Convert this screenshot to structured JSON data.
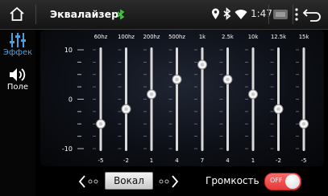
{
  "statusbar": {
    "title": "Эквалайзер",
    "clock": "1:47"
  },
  "sidebar": {
    "items": [
      {
        "label": "Эффек",
        "icon": "equalizer-icon",
        "active": true
      },
      {
        "label": "Поле",
        "icon": "speaker-icon",
        "active": false
      }
    ]
  },
  "equalizer": {
    "bands": [
      {
        "freq": "60hz",
        "value": -5
      },
      {
        "freq": "100hz",
        "value": -2
      },
      {
        "freq": "200hz",
        "value": 1
      },
      {
        "freq": "500hz",
        "value": 4
      },
      {
        "freq": "1k",
        "value": 7
      },
      {
        "freq": "2.5k",
        "value": 4
      },
      {
        "freq": "10k",
        "value": 1
      },
      {
        "freq": "12.5k",
        "value": -2
      },
      {
        "freq": "15k",
        "value": -5
      }
    ],
    "scale": {
      "max": "10",
      "mid": "0",
      "min": "-10",
      "range": [
        -10,
        10
      ]
    }
  },
  "controls": {
    "preset": "Вокал",
    "loudness_label": "Громкость",
    "loudness_state": "OFF"
  },
  "colors": {
    "accent_active": "#4a9fe0",
    "toggle_off": "#ef4444"
  }
}
